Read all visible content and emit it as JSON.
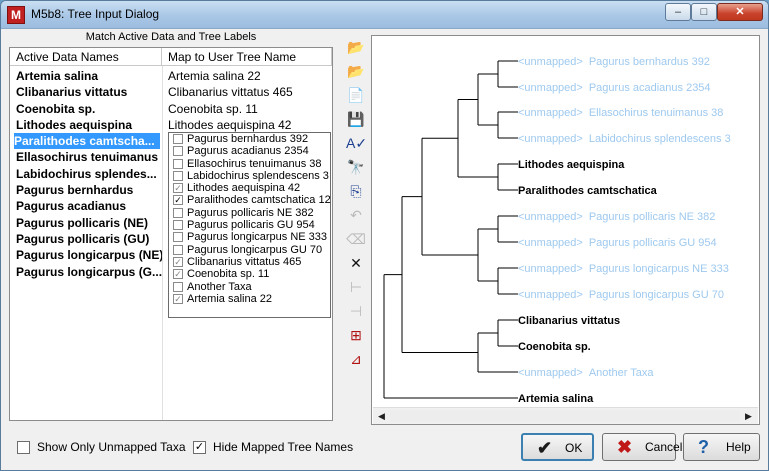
{
  "window": {
    "title": "M5b8: Tree Input Dialog",
    "minimize": "–",
    "maximize": "□",
    "close": "✕",
    "app_icon": "M"
  },
  "match": {
    "header": "Match Active Data and Tree Labels",
    "col_names": "Active Data Names",
    "col_map": "Map to User Tree Name",
    "rows": [
      {
        "name": "Artemia salina",
        "map": "Artemia salina 22"
      },
      {
        "name": "Clibanarius vittatus",
        "map": "Clibanarius vittatus 465"
      },
      {
        "name": "Coenobita sp.",
        "map": "Coenobita sp. 11"
      },
      {
        "name": "Lithodes aequispina",
        "map": "Lithodes aequispina 42"
      },
      {
        "name": "Paralithodes camtscha...",
        "map": ""
      },
      {
        "name": "Ellasochirus tenuimanus",
        "map": ""
      },
      {
        "name": "Labidochirus splendes...",
        "map": ""
      },
      {
        "name": "Pagurus bernhardus",
        "map": ""
      },
      {
        "name": "Pagurus acadianus",
        "map": ""
      },
      {
        "name": "Pagurus pollicaris (NE)",
        "map": ""
      },
      {
        "name": "Pagurus pollicaris (GU)",
        "map": ""
      },
      {
        "name": "Pagurus longicarpus (NE)",
        "map": ""
      },
      {
        "name": "Pagurus longicarpus (G...",
        "map": ""
      }
    ]
  },
  "dropdown": {
    "items": [
      {
        "label": "Pagurus bernhardus 392",
        "check": "",
        "grey": false
      },
      {
        "label": "Pagurus acadianus 2354",
        "check": "",
        "grey": false
      },
      {
        "label": "Ellasochirus tenuimanus 38",
        "check": "",
        "grey": false
      },
      {
        "label": "Labidochirus splendescens 3",
        "check": "",
        "grey": false
      },
      {
        "label": "Lithodes aequispina 42",
        "check": "✓",
        "grey": true
      },
      {
        "label": "Paralithodes camtschatica 12",
        "check": "✓",
        "grey": false
      },
      {
        "label": "Pagurus pollicaris NE 382",
        "check": "",
        "grey": false
      },
      {
        "label": "Pagurus pollicaris GU 954",
        "check": "",
        "grey": false
      },
      {
        "label": "Pagurus longicarpus NE 333",
        "check": "",
        "grey": false
      },
      {
        "label": "Pagurus longicarpus GU 70",
        "check": "",
        "grey": false
      },
      {
        "label": "Clibanarius vittatus 465",
        "check": "✓",
        "grey": true
      },
      {
        "label": "Coenobita sp. 11",
        "check": "✓",
        "grey": true
      },
      {
        "label": "Another Taxa",
        "check": "",
        "grey": false
      },
      {
        "label": "Artemia salina 22",
        "check": "✓",
        "grey": true
      }
    ]
  },
  "toolbar": {
    "tools": [
      {
        "icon": "open-folder-icon",
        "glyph": "📂",
        "enabled": true
      },
      {
        "icon": "open-folder-special-icon",
        "glyph": "📂",
        "enabled": true
      },
      {
        "icon": "document-icon",
        "glyph": "📄",
        "enabled": true
      },
      {
        "icon": "save-icon",
        "glyph": "💾",
        "enabled": true
      },
      {
        "icon": "spell-check-icon",
        "glyph": "A✓",
        "enabled": true
      },
      {
        "icon": "find-icon",
        "glyph": "🔭",
        "enabled": true
      },
      {
        "icon": "copy-icon",
        "glyph": "⎘",
        "enabled": true
      },
      {
        "icon": "undo-icon",
        "glyph": "↶",
        "enabled": false
      },
      {
        "icon": "clean-icon",
        "glyph": "⌫",
        "enabled": false
      },
      {
        "icon": "delete-icon",
        "glyph": "✕",
        "enabled": true
      },
      {
        "icon": "add-branch-icon",
        "glyph": "⊢",
        "enabled": false
      },
      {
        "icon": "collapse-branch-icon",
        "glyph": "⊣",
        "enabled": false
      },
      {
        "icon": "tree-frame-icon",
        "glyph": "⊞",
        "enabled": true
      },
      {
        "icon": "tree-edit-icon",
        "glyph": "⊿",
        "enabled": true
      }
    ]
  },
  "tree": {
    "unmapped_prefix": "<unmapped>",
    "unmapped_color": "#9ec9ef",
    "labels": [
      {
        "prefix": "<unmapped>",
        "text": "Pagurus bernhardus 392",
        "mapped": false
      },
      {
        "prefix": "<unmapped>",
        "text": "Pagurus acadianus 2354",
        "mapped": false
      },
      {
        "prefix": "<unmapped>",
        "text": "Ellasochirus tenuimanus 38",
        "mapped": false
      },
      {
        "prefix": "<unmapped>",
        "text": "Labidochirus splendescens 3",
        "mapped": false
      },
      {
        "prefix": "",
        "text": "Lithodes aequispina",
        "mapped": true
      },
      {
        "prefix": "",
        "text": "Paralithodes camtschatica",
        "mapped": true
      },
      {
        "prefix": "<unmapped>",
        "text": "Pagurus pollicaris NE 382",
        "mapped": false
      },
      {
        "prefix": "<unmapped>",
        "text": "Pagurus pollicaris GU 954",
        "mapped": false
      },
      {
        "prefix": "<unmapped>",
        "text": "Pagurus longicarpus NE 333",
        "mapped": false
      },
      {
        "prefix": "<unmapped>",
        "text": "Pagurus longicarpus GU 70",
        "mapped": false
      },
      {
        "prefix": "",
        "text": "Clibanarius vittatus",
        "mapped": true
      },
      {
        "prefix": "",
        "text": "Coenobita sp.",
        "mapped": true
      },
      {
        "prefix": "<unmapped>",
        "text": "Another Taxa",
        "mapped": false
      },
      {
        "prefix": "",
        "text": "Artemia salina",
        "mapped": true
      }
    ],
    "scroll_left": "◀",
    "scroll_right": "▶"
  },
  "bottom": {
    "show_unmapped": {
      "label": "Show Only Unmapped Taxa",
      "checked": ""
    },
    "hide_mapped": {
      "label": "Hide Mapped Tree Names",
      "checked": "✓"
    },
    "ok": {
      "label": "OK",
      "glyph": "✔"
    },
    "cancel": {
      "label": "Cancel",
      "glyph": "✖"
    },
    "help": {
      "label": "Help",
      "glyph": "?"
    }
  }
}
